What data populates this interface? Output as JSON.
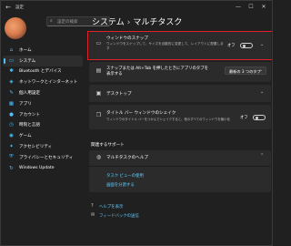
{
  "app": {
    "title": "設定",
    "back": "←",
    "minimize": "—",
    "maximize": "☐",
    "close": "✕"
  },
  "search": {
    "placeholder": "設定の検索"
  },
  "breadcrumb": {
    "parent": "システム",
    "separator": "›",
    "current": "マルチタスク"
  },
  "sidebar": {
    "items": [
      {
        "label": "ホーム",
        "icon": "⌂"
      },
      {
        "label": "システム",
        "icon": "▭",
        "active": true
      },
      {
        "label": "Bluetooth とデバイス",
        "icon": "✱"
      },
      {
        "label": "ネットワークとインターネット",
        "icon": "◈"
      },
      {
        "label": "個人用設定",
        "icon": "✎"
      },
      {
        "label": "アプリ",
        "icon": "▦"
      },
      {
        "label": "アカウント",
        "icon": "●"
      },
      {
        "label": "時刻と言語",
        "icon": "◷"
      },
      {
        "label": "ゲーム",
        "icon": "◉"
      },
      {
        "label": "アクセシビリティ",
        "icon": "✦"
      },
      {
        "label": "プライバシーとセキュリティ",
        "icon": "⛨"
      },
      {
        "label": "Windows Update",
        "icon": "↻"
      }
    ]
  },
  "settings": {
    "snap": {
      "title": "ウィンドウのスナップ",
      "desc1": "ウィンドウをスナップして、サイズを自動的に変更して、レイアウトに配置しま",
      "desc2": "す",
      "toggle_label": "オフ",
      "icon": "snap-icon"
    },
    "alt_tab": {
      "title1": "スナップまたは Alt+Tab を押したときにアプリのタブを",
      "title2": "表示する",
      "dropdown": "最新の 3 つのタブ",
      "arrow": "⌄"
    },
    "desktops": {
      "title": "デスクトップ",
      "chev": "⌄"
    },
    "shake": {
      "title": "タイトル バー ウィンドウのシェイク",
      "desc": "ウィンドウのタイトル バーをつかんでシェイクすると、他のすべてのウィンドウを最小化",
      "toggle_label": "オフ"
    }
  },
  "related": {
    "section": "関連するサポート",
    "help_title": "マルチタスクのヘルプ",
    "links": [
      "タスク ビューの使用",
      "画面を分割する"
    ]
  },
  "footer": {
    "help": "ヘルプを表示",
    "feedback": "フィードバックの送信"
  },
  "colors": {
    "accent": "#4cc2ff",
    "link": "#60cdff",
    "highlight": "#e0202a"
  }
}
